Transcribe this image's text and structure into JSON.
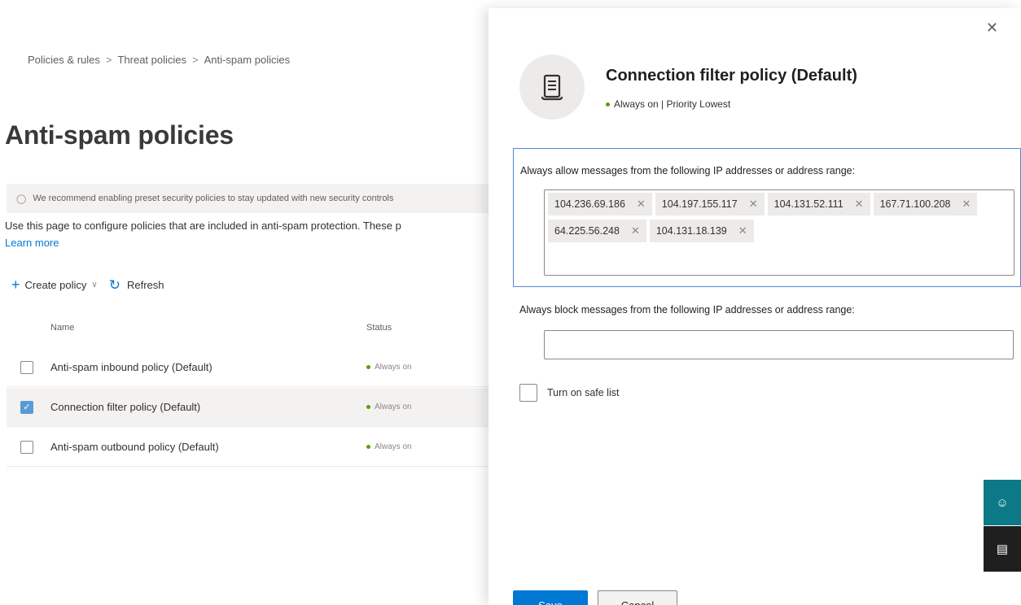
{
  "breadcrumb": [
    "Policies & rules",
    "Threat policies",
    "Anti-spam policies"
  ],
  "page_title": "Anti-spam policies",
  "banner_text": "We recommend enabling preset security policies to stay updated with new security controls",
  "description": "Use this page to configure policies that are included in anti-spam protection. These p",
  "learn_more": "Learn more",
  "toolbar": {
    "create_label": "Create policy",
    "refresh_label": "Refresh"
  },
  "table": {
    "headers": {
      "name": "Name",
      "status": "Status"
    },
    "rows": [
      {
        "name": "Anti-spam inbound policy (Default)",
        "status": "Always on",
        "selected": false
      },
      {
        "name": "Connection filter policy (Default)",
        "status": "Always on",
        "selected": true
      },
      {
        "name": "Anti-spam outbound policy (Default)",
        "status": "Always on",
        "selected": false
      }
    ]
  },
  "panel": {
    "title": "Connection filter policy (Default)",
    "subtitle": "Always on | Priority Lowest",
    "allow_label": "Always allow messages from the following IP addresses or address range:",
    "allow_ips": [
      "104.236.69.186",
      "104.197.155.117",
      "104.131.52.111",
      "167.71.100.208",
      "64.225.56.248",
      "104.131.18.139"
    ],
    "block_label": "Always block messages from the following IP addresses or address range:",
    "block_value": "",
    "safe_list_label": "Turn on safe list",
    "safe_list_checked": false,
    "save_label": "Save",
    "cancel_label": "Cancel"
  },
  "icons": {
    "close": "close-icon",
    "policy": "scroll-document-icon",
    "help": "help-icon",
    "feedback": "feedback-icon"
  },
  "colors": {
    "accent": "#0078d4",
    "status_green": "#57a300",
    "help_teal": "#0b7a86"
  }
}
